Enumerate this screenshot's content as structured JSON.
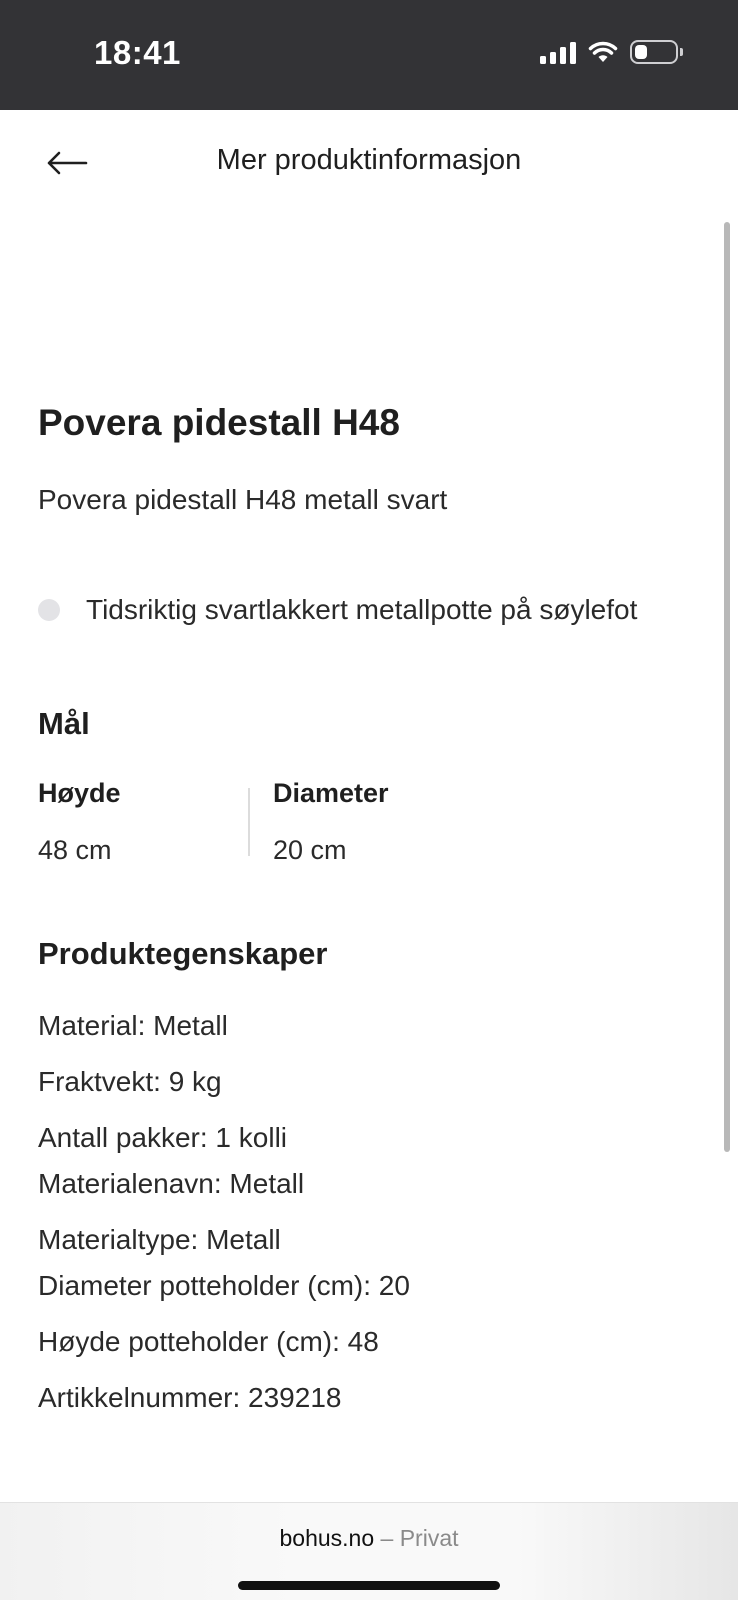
{
  "status_bar": {
    "time": "18:41"
  },
  "header": {
    "title": "Mer produktinformasjon"
  },
  "product": {
    "title": "Povera pidestall H48",
    "subtitle": "Povera pidestall H48 metall svart",
    "bullet": "Tidsriktig svartlakkert metallpotte på søylefot"
  },
  "dimensions": {
    "heading": "Mål",
    "items": [
      {
        "label": "Høyde",
        "value": "48 cm"
      },
      {
        "label": "Diameter",
        "value": "20 cm"
      }
    ]
  },
  "properties": {
    "heading": "Produktegenskaper",
    "items": [
      "Material: Metall",
      "Fraktvekt: 9 kg",
      "Antall pakker: 1 kolli",
      "Materialenavn: Metall",
      "Materialtype: Metall",
      "Diameter potteholder (cm): 20",
      "Høyde potteholder (cm): 48",
      "Artikkelnummer: 239218"
    ]
  },
  "browser": {
    "domain": "bohus.no",
    "separator": " – ",
    "mode": "Privat"
  }
}
